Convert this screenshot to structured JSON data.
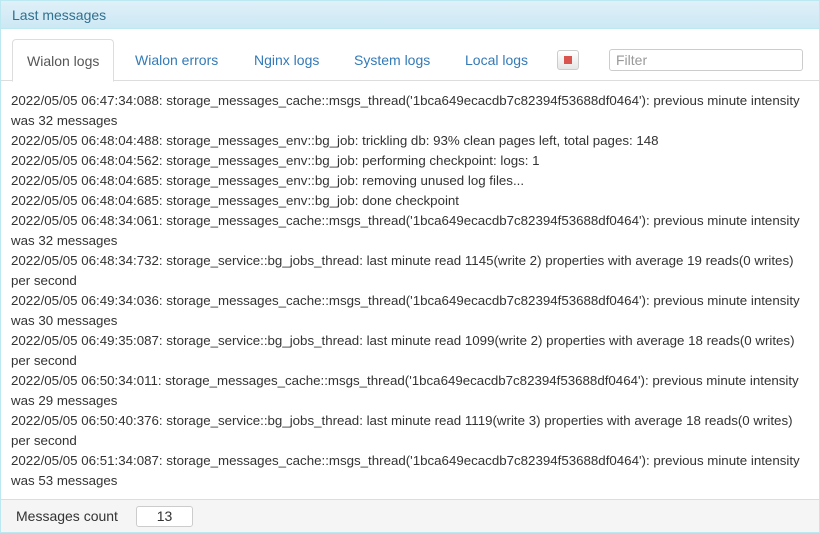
{
  "header": {
    "title": "Last messages"
  },
  "tabs": [
    {
      "label": "Wialon logs",
      "active": true
    },
    {
      "label": "Wialon errors"
    },
    {
      "label": "Nginx logs"
    },
    {
      "label": "System logs"
    },
    {
      "label": "Local logs"
    }
  ],
  "toolbar": {
    "stop_icon": "stop-square-icon",
    "stop_color": "#d9534f",
    "filter_placeholder": "Filter",
    "filter_value": ""
  },
  "messages": [
    "2022/05/05 06:47:34:088: storage_messages_cache::msgs_thread('1bca649ecacdb7c82394f53688df0464'): previous minute intensity was 32 messages",
    "2022/05/05 06:48:04:488: storage_messages_env::bg_job: trickling db: 93% clean pages left, total pages: 148",
    "2022/05/05 06:48:04:562: storage_messages_env::bg_job: performing checkpoint: logs: 1",
    "2022/05/05 06:48:04:685: storage_messages_env::bg_job: removing unused log files...",
    "2022/05/05 06:48:04:685: storage_messages_env::bg_job: done checkpoint",
    "2022/05/05 06:48:34:061: storage_messages_cache::msgs_thread('1bca649ecacdb7c82394f53688df0464'): previous minute intensity was 32 messages",
    "2022/05/05 06:48:34:732: storage_service::bg_jobs_thread: last minute read 1145(write 2) properties with average 19 reads(0 writes) per second",
    "2022/05/05 06:49:34:036: storage_messages_cache::msgs_thread('1bca649ecacdb7c82394f53688df0464'): previous minute intensity was 30 messages",
    "2022/05/05 06:49:35:087: storage_service::bg_jobs_thread: last minute read 1099(write 2) properties with average 18 reads(0 writes) per second",
    "2022/05/05 06:50:34:011: storage_messages_cache::msgs_thread('1bca649ecacdb7c82394f53688df0464'): previous minute intensity was 29 messages",
    "2022/05/05 06:50:40:376: storage_service::bg_jobs_thread: last minute read 1119(write 3) properties with average 18 reads(0 writes) per second",
    "2022/05/05 06:51:34:087: storage_messages_cache::msgs_thread('1bca649ecacdb7c82394f53688df0464'): previous minute intensity was 53 messages"
  ],
  "footer": {
    "label": "Messages count",
    "count": "13"
  }
}
